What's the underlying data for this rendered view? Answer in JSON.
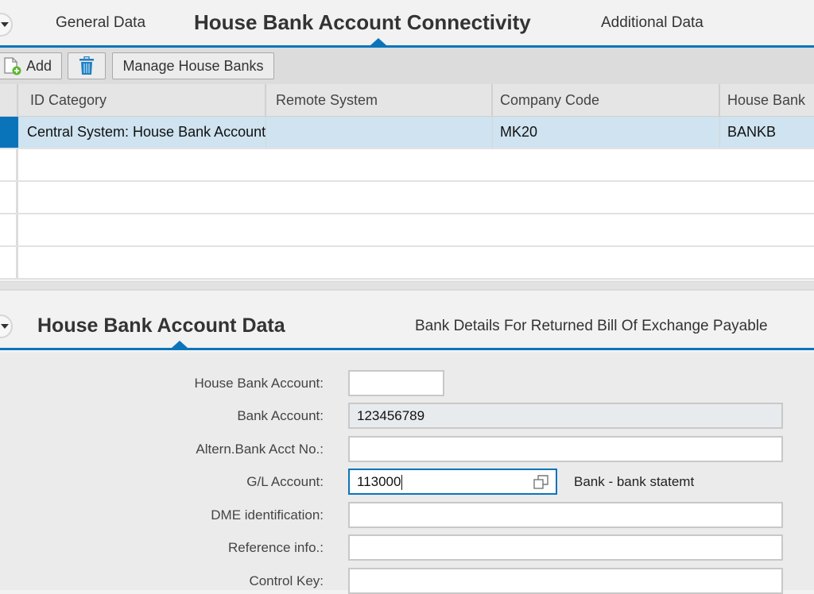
{
  "top_tabs": {
    "collapse_icon": "chevron-down-circle-icon",
    "items": [
      {
        "label": "General Data",
        "active": false
      },
      {
        "label": "House Bank Account Connectivity",
        "active": true
      },
      {
        "label": "Additional Data",
        "active": false
      }
    ]
  },
  "toolbar": {
    "add_label": "Add",
    "add_icon": "document-add-icon",
    "delete_icon": "trash-icon",
    "manage_label": "Manage House Banks"
  },
  "table": {
    "columns": [
      "ID Category",
      "Remote System",
      "Company Code",
      "House Bank"
    ],
    "rows": [
      {
        "selected": true,
        "cells": [
          "Central System: House Bank Account",
          "",
          "MK20",
          "BANKB"
        ]
      },
      {
        "selected": false,
        "cells": [
          "",
          "",
          "",
          ""
        ]
      },
      {
        "selected": false,
        "cells": [
          "",
          "",
          "",
          ""
        ]
      },
      {
        "selected": false,
        "cells": [
          "",
          "",
          "",
          ""
        ]
      },
      {
        "selected": false,
        "cells": [
          "",
          "",
          "",
          ""
        ]
      }
    ]
  },
  "bottom_tabs": {
    "collapse_icon": "chevron-down-circle-icon",
    "items": [
      {
        "label": "House Bank Account Data",
        "active": true
      },
      {
        "label": "Bank Details For Returned Bill Of Exchange Payable",
        "active": false
      }
    ]
  },
  "form": {
    "fields": [
      {
        "label": "House Bank Account:",
        "value": ""
      },
      {
        "label": "Bank Account:",
        "value": "123456789",
        "readonly": true
      },
      {
        "label": "Altern.Bank Acct No.:",
        "value": ""
      },
      {
        "label": "G/L Account:",
        "value": "113000",
        "focused": true,
        "value_help_icon": "value-help-icon",
        "description": "Bank - bank statemt"
      },
      {
        "label": "DME identification:",
        "value": ""
      },
      {
        "label": "Reference info.:",
        "value": ""
      },
      {
        "label": "Control Key:",
        "value": ""
      }
    ]
  },
  "colors": {
    "accent": "#0a74bb",
    "selected_row": "#cfe3f0",
    "toolbar_bg": "#dcdcdc",
    "form_bg": "#ebebeb",
    "add_icon_green": "#5cb82e"
  }
}
